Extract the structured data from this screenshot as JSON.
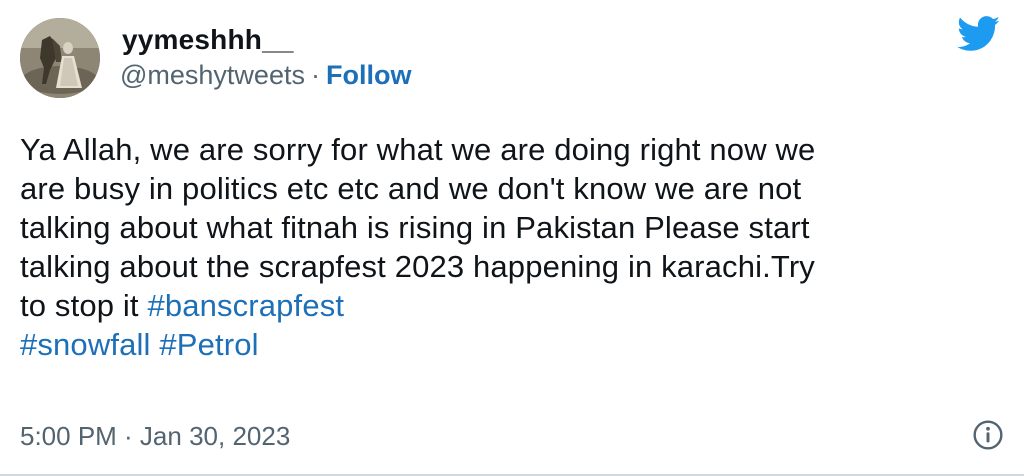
{
  "author": {
    "display_name": "yymeshhh__",
    "handle": "@meshytweets",
    "separator": "·",
    "follow_label": "Follow"
  },
  "tweet": {
    "lines": [
      "Ya Allah, we are sorry for what we are doing right now we",
      "are busy in politics etc etc and we don't know we are not",
      "talking about what fitnah is rising in Pakistan Please start",
      "talking about the scrapfest 2023 happening in karachi.Try",
      "to stop it "
    ],
    "hashtags": [
      "#banscrapfest",
      "#snowfall",
      "#Petrol"
    ],
    "timestamp": "5:00 PM · Jan 30, 2023"
  },
  "icons": {
    "brand": "twitter-bird-icon",
    "info": "info-icon",
    "avatar": "avatar-photo"
  },
  "colors": {
    "link": "#1d70b8",
    "twitter_blue": "#1d9bf0",
    "text": "#0f1419",
    "secondary": "#536471",
    "divider": "#cfd9de"
  }
}
